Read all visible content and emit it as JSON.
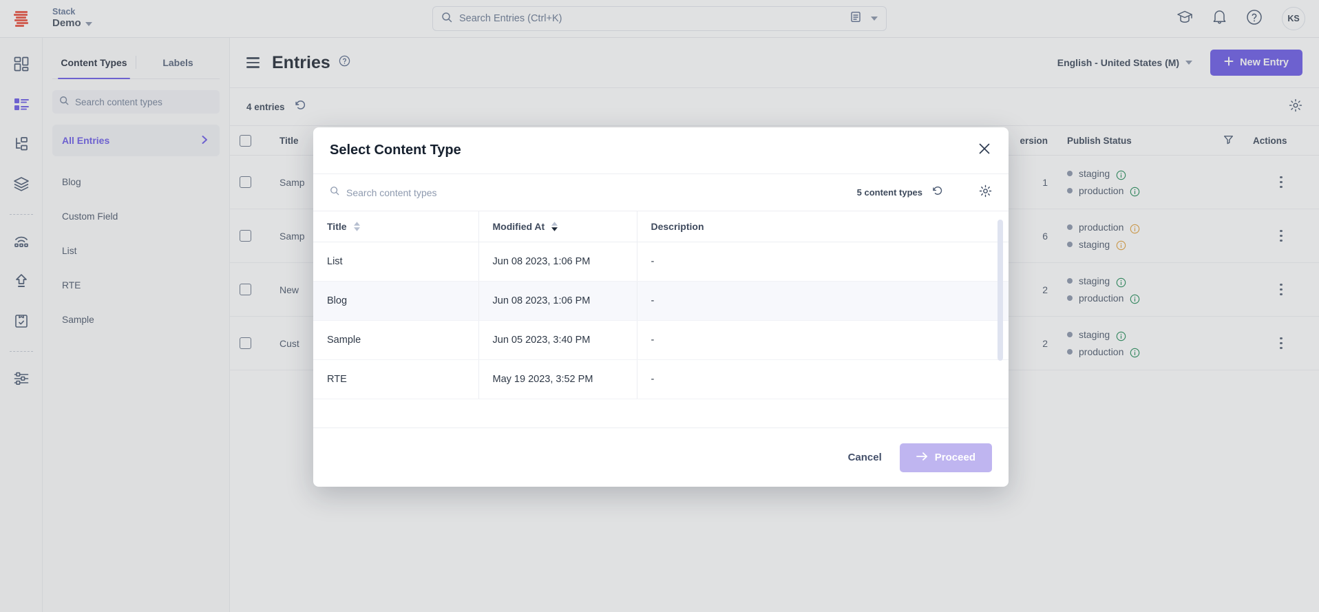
{
  "topbar": {
    "logo": "contentstack-logo",
    "stack_label": "Stack",
    "stack_name": "Demo",
    "search_placeholder": "Search Entries (Ctrl+K)",
    "search_value": "",
    "save_icon": "save-disk-icon",
    "academy_icon": "graduation-cap-icon",
    "notifications_icon": "bell-icon",
    "help_icon": "help-circle-icon",
    "avatar_initials": "KS"
  },
  "rail": {
    "items": [
      {
        "name": "dashboard",
        "icon": "dashboard-grid-icon",
        "active": false
      },
      {
        "name": "entries",
        "icon": "entries-list-icon",
        "active": true
      },
      {
        "name": "taxonomy",
        "icon": "taxonomy-tree-icon",
        "active": false
      },
      {
        "name": "assets",
        "icon": "assets-layers-icon",
        "active": false
      },
      {
        "name": "live-preview",
        "icon": "live-preview-icon",
        "active": false
      },
      {
        "name": "publish-queue",
        "icon": "publish-upload-icon",
        "active": false
      },
      {
        "name": "releases",
        "icon": "releases-clipboard-icon",
        "active": false
      },
      {
        "name": "settings",
        "icon": "settings-sliders-icon",
        "active": false
      }
    ]
  },
  "sidebar": {
    "tabs": [
      {
        "label": "Content Types",
        "active": true
      },
      {
        "label": "Labels",
        "active": false
      }
    ],
    "search_placeholder": "Search content types",
    "search_value": "",
    "all_entries_label": "All Entries",
    "chevron_icon": "chevron-right-icon",
    "items": [
      {
        "label": "Blog"
      },
      {
        "label": "Custom Field"
      },
      {
        "label": "List"
      },
      {
        "label": "RTE"
      },
      {
        "label": "Sample"
      }
    ]
  },
  "main": {
    "menu_icon": "hamburger-menu-icon",
    "title": "Entries",
    "help_icon": "help-circle-icon",
    "locale": "English - United States (M)",
    "new_entry_label": "New Entry",
    "plus_icon": "plus-icon",
    "entries_count": "4 entries",
    "refresh_icon": "refresh-icon",
    "gear_icon": "gear-icon",
    "filter_icon": "filter-icon",
    "columns": [
      "Title",
      "ersion",
      "Publish Status",
      "Actions"
    ],
    "rows": [
      {
        "title": "Samp",
        "version": "1",
        "publish": [
          {
            "env": "staging",
            "state": "published"
          },
          {
            "env": "production",
            "state": "published"
          }
        ]
      },
      {
        "title": "Samp",
        "version": "6",
        "publish": [
          {
            "env": "production",
            "state": "warning"
          },
          {
            "env": "staging",
            "state": "warning"
          }
        ]
      },
      {
        "title": "New",
        "version": "2",
        "publish": [
          {
            "env": "staging",
            "state": "published"
          },
          {
            "env": "production",
            "state": "published"
          }
        ]
      },
      {
        "title": "Cust",
        "version": "2",
        "publish": [
          {
            "env": "staging",
            "state": "published"
          },
          {
            "env": "production",
            "state": "published"
          }
        ]
      }
    ]
  },
  "modal": {
    "title": "Select Content Type",
    "close_icon": "close-icon",
    "search_placeholder": "Search content types",
    "search_value": "",
    "count_label": "5 content types",
    "refresh_icon": "refresh-icon",
    "gear_icon": "gear-icon",
    "columns": [
      {
        "label": "Title",
        "sortable": true,
        "sorted": "none"
      },
      {
        "label": "Modified At",
        "sortable": true,
        "sorted": "desc"
      },
      {
        "label": "Description",
        "sortable": false,
        "sorted": "none"
      }
    ],
    "rows": [
      {
        "title": "List",
        "modified_at": "Jun 08 2023, 1:06 PM",
        "description": "-"
      },
      {
        "title": "Blog",
        "modified_at": "Jun 08 2023, 1:06 PM",
        "description": "-"
      },
      {
        "title": "Sample",
        "modified_at": "Jun 05 2023, 3:40 PM",
        "description": "-"
      },
      {
        "title": "RTE",
        "modified_at": "May 19 2023, 3:52 PM",
        "description": "-"
      }
    ],
    "cancel_label": "Cancel",
    "proceed_label": "Proceed",
    "proceed_icon": "arrow-right-icon",
    "proceed_disabled": true
  },
  "colors": {
    "brand_purple": "#6c5ce7",
    "proceed_disabled": "#bfb5f0",
    "logo_red": "#eb5646",
    "status_green": "#1f8a55",
    "status_orange": "#e2a13b",
    "text_dark": "#16202e",
    "text_muted": "#4d596c"
  }
}
